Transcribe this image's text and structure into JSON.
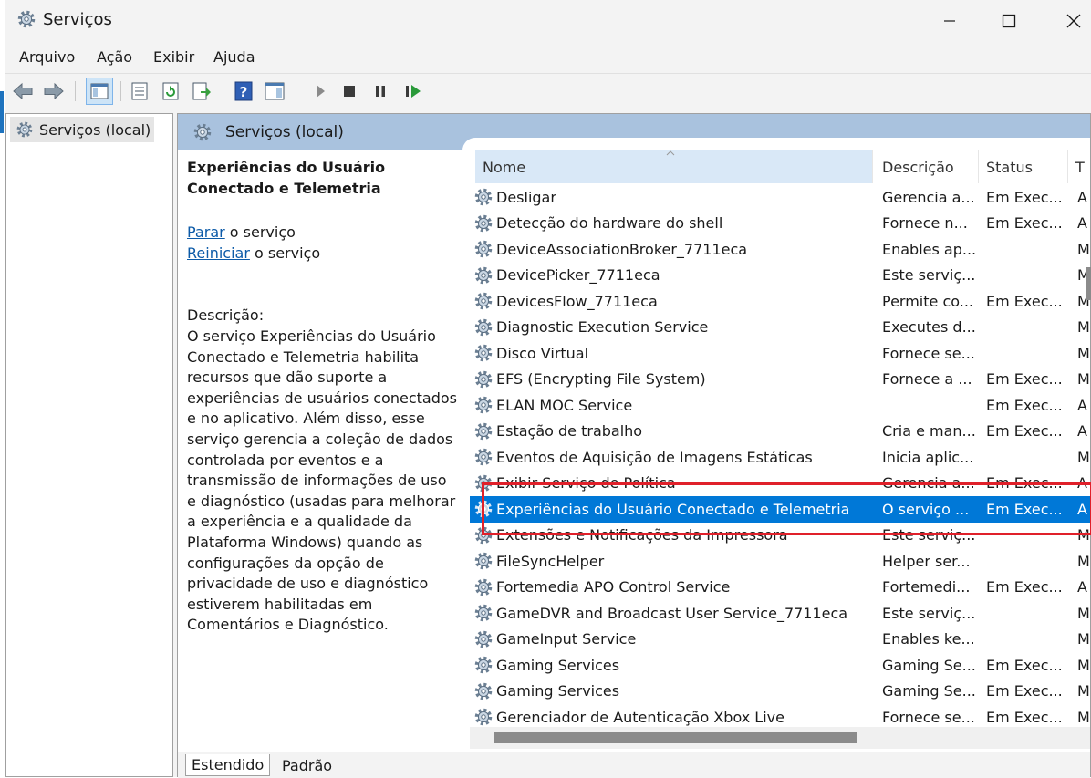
{
  "window": {
    "title": "Serviços"
  },
  "menu": [
    "Arquivo",
    "Ação",
    "Exibir",
    "Ajuda"
  ],
  "tree": {
    "root_label": "Serviços (local)"
  },
  "detail": {
    "header_title": "Serviços (local)",
    "service_name": "Experiências do Usuário Conectado e Telemetria",
    "stop_link": "Parar",
    "stop_suffix": " o serviço",
    "restart_link": "Reiniciar",
    "restart_suffix": " o serviço",
    "description_label": "Descrição:",
    "description_text": "O serviço Experiências do Usuário Conectado e Telemetria habilita recursos que dão suporte a experiências de usuários conectados e no aplicativo. Além disso, esse serviço gerencia a coleção de dados controlada por eventos e a transmissão de informações de uso e diagnóstico (usadas para melhorar a experiência e a qualidade da Plataforma Windows) quando as configurações da opção de privacidade de uso e diagnóstico estiverem habilitadas em Comentários e Diagnóstico."
  },
  "columns": {
    "name": "Nome",
    "desc": "Descrição",
    "status": "Status",
    "type": "T"
  },
  "rows": [
    {
      "name": "Desligar",
      "desc": "Gerencia a...",
      "status": "Em Exec...",
      "type": "A"
    },
    {
      "name": "Detecção do hardware do shell",
      "desc": "Fornece n...",
      "status": "Em Exec...",
      "type": "A"
    },
    {
      "name": "DeviceAssociationBroker_7711eca",
      "desc": "Enables ap...",
      "status": "",
      "type": "M"
    },
    {
      "name": "DevicePicker_7711eca",
      "desc": "Este serviç...",
      "status": "",
      "type": "M"
    },
    {
      "name": "DevicesFlow_7711eca",
      "desc": "Permite co...",
      "status": "Em Exec...",
      "type": "M"
    },
    {
      "name": "Diagnostic Execution Service",
      "desc": "Executes d...",
      "status": "",
      "type": "M"
    },
    {
      "name": "Disco Virtual",
      "desc": "Fornece se...",
      "status": "",
      "type": "M"
    },
    {
      "name": "EFS (Encrypting File System)",
      "desc": "Fornece a ...",
      "status": "Em Exec...",
      "type": "M"
    },
    {
      "name": "ELAN MOC Service",
      "desc": "",
      "status": "Em Exec...",
      "type": "A"
    },
    {
      "name": "Estação de trabalho",
      "desc": "Cria e man...",
      "status": "Em Exec...",
      "type": "A"
    },
    {
      "name": "Eventos de Aquisição de Imagens Estáticas",
      "desc": "Inicia aplic...",
      "status": "",
      "type": "M"
    },
    {
      "name": "Exibir Serviço de Política",
      "desc": "Gerencia a...",
      "status": "Em Exec...",
      "type": "A"
    },
    {
      "name": "Experiências do Usuário Conectado e Telemetria",
      "desc": "O serviço ...",
      "status": "Em Exec...",
      "type": "A",
      "selected": true
    },
    {
      "name": "Extensões e Notificações da Impressora",
      "desc": "Este serviç...",
      "status": "",
      "type": "M"
    },
    {
      "name": "FileSyncHelper",
      "desc": "Helper ser...",
      "status": "",
      "type": "M"
    },
    {
      "name": "Fortemedia APO Control Service",
      "desc": "Fortemedi...",
      "status": "Em Exec...",
      "type": "A"
    },
    {
      "name": "GameDVR and Broadcast User Service_7711eca",
      "desc": "Este serviç...",
      "status": "",
      "type": "M"
    },
    {
      "name": "GameInput Service",
      "desc": "Enables ke...",
      "status": "",
      "type": "M"
    },
    {
      "name": "Gaming Services",
      "desc": "Gaming Se...",
      "status": "Em Exec...",
      "type": "M"
    },
    {
      "name": "Gaming Services",
      "desc": "Gaming Se...",
      "status": "Em Exec...",
      "type": "M"
    },
    {
      "name": "Gerenciador de Autenticação Xbox Live",
      "desc": "Fornece se...",
      "status": "Em Exec...",
      "type": "M"
    }
  ],
  "tabs": [
    "Estendido",
    "Padrão"
  ],
  "colors": {
    "header_bg": "#a9c2de",
    "selected_row": "#0078d7",
    "highlight": "#e0202a",
    "link": "#0d5ba8"
  }
}
